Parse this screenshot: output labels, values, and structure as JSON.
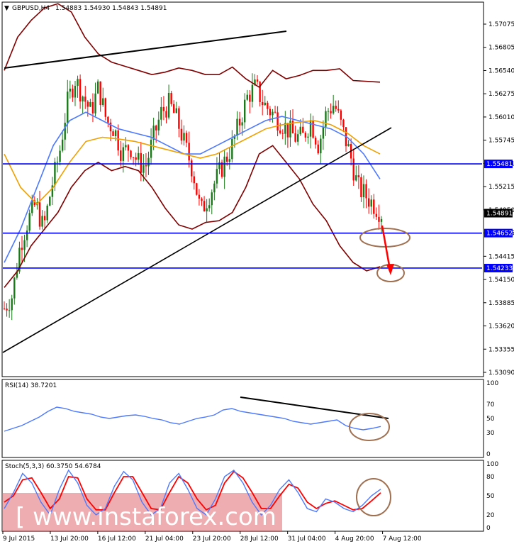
{
  "header": {
    "symbol": "GBPUSD,H4",
    "ohlc": "1.54883 1.54930 1.54843 1.54891"
  },
  "colors": {
    "bull_candle": "#1a7a1a",
    "bear_candle": "#ff0000",
    "bollinger": "#800000",
    "ma_fast": "#ff0000",
    "ma_mid": "#4d79ff",
    "ma_slow": "#f0a000",
    "level_line": "#0000ff",
    "annotation": "#a07050"
  },
  "watermark": {
    "text": "[ www.instaforex.com ]"
  },
  "chart_data": [
    {
      "type": "candlestick",
      "name": "main",
      "ylim": [
        1.5295,
        1.5741
      ],
      "y_ticks": [
        "1.57075",
        "1.56805",
        "1.56540",
        "1.56275",
        "1.56010",
        "1.55745",
        "1.55481",
        "1.55215",
        "1.54950",
        "1.54685",
        "1.54415",
        "1.54150",
        "1.53885",
        "1.53620",
        "1.53355",
        "1.53090"
      ],
      "x_ticks": [
        "9 Jul 2015",
        "13 Jul 20:00",
        "16 Jul 12:00",
        "21 Jul 04:00",
        "23 Jul 20:00",
        "28 Jul 12:00",
        "31 Jul 04:00",
        "4 Aug 20:00",
        "7 Aug 12:00"
      ],
      "levels": [
        {
          "label": "1.55481",
          "value": 1.55481
        },
        {
          "label": "1.54652",
          "value": 1.54652
        },
        {
          "label": "1.54233",
          "value": 1.54233
        }
      ],
      "current_price_label": "1.54891",
      "current_price": 1.54891,
      "close_path": [
        1.5375,
        1.539,
        1.545,
        1.548,
        1.55,
        1.547,
        1.552,
        1.556,
        1.562,
        1.565,
        1.563,
        1.561,
        1.564,
        1.56,
        1.559,
        1.556,
        1.557,
        1.555,
        1.5545,
        1.558,
        1.561,
        1.562,
        1.56,
        1.557,
        1.554,
        1.549,
        1.551,
        1.553,
        1.555,
        1.557,
        1.56,
        1.563,
        1.564,
        1.562,
        1.561,
        1.56,
        1.559,
        1.558,
        1.558,
        1.56,
        1.557,
        1.561,
        1.562,
        1.559,
        1.556,
        1.552,
        1.551,
        1.55,
        1.5489
      ],
      "bollinger_upper": [
        1.566,
        1.57,
        1.572,
        1.5735,
        1.574,
        1.573,
        1.57,
        1.568,
        1.567,
        1.5665,
        1.566,
        1.5655,
        1.5658,
        1.5663,
        1.566,
        1.5655,
        1.5655,
        1.5664,
        1.565,
        1.564,
        1.566,
        1.565,
        1.5654,
        1.566,
        1.566,
        1.5662,
        1.5648,
        1.5647,
        1.5646
      ],
      "bollinger_lower": [
        1.54,
        1.542,
        1.545,
        1.547,
        1.549,
        1.552,
        1.554,
        1.555,
        1.554,
        1.5545,
        1.554,
        1.552,
        1.5495,
        1.5475,
        1.547,
        1.5478,
        1.548,
        1.549,
        1.552,
        1.556,
        1.557,
        1.555,
        1.553,
        1.55,
        1.548,
        1.545,
        1.543,
        1.542,
        1.5425
      ],
      "ma_mid": [
        1.543,
        1.547,
        1.552,
        1.557,
        1.56,
        1.561,
        1.56,
        1.559,
        1.5585,
        1.558,
        1.557,
        1.556,
        1.556,
        1.557,
        1.558,
        1.559,
        1.56,
        1.5605,
        1.56,
        1.5595,
        1.559,
        1.558,
        1.556,
        1.553
      ],
      "ma_slow": [
        1.556,
        1.552,
        1.55,
        1.552,
        1.555,
        1.5575,
        1.558,
        1.5578,
        1.5575,
        1.557,
        1.5565,
        1.556,
        1.5555,
        1.556,
        1.557,
        1.558,
        1.559,
        1.5595,
        1.5598,
        1.56,
        1.5595,
        1.5585,
        1.557,
        1.556
      ]
    },
    {
      "type": "line",
      "name": "rsi",
      "label": "RSI(14) 38.7201",
      "ylim": [
        0,
        100
      ],
      "y_ticks": [
        "100",
        "70",
        "50",
        "30",
        "0"
      ],
      "values": [
        32,
        36,
        40,
        46,
        52,
        60,
        66,
        64,
        60,
        58,
        56,
        52,
        50,
        52,
        54,
        55,
        53,
        50,
        48,
        44,
        42,
        46,
        50,
        52,
        55,
        62,
        64,
        60,
        58,
        56,
        54,
        52,
        50,
        46,
        44,
        42,
        44,
        46,
        48,
        40,
        36,
        34,
        36,
        38.7
      ]
    },
    {
      "type": "line",
      "name": "stochastic",
      "label": "Stoch(5,3,3) 60.3750 54.6784",
      "ylim": [
        0,
        100
      ],
      "y_ticks": [
        "100",
        "80",
        "50",
        "20",
        "0"
      ],
      "main": [
        30,
        55,
        85,
        70,
        40,
        20,
        60,
        90,
        70,
        35,
        20,
        30,
        65,
        88,
        75,
        40,
        20,
        30,
        70,
        85,
        60,
        30,
        20,
        45,
        80,
        90,
        70,
        40,
        20,
        35,
        60,
        75,
        55,
        30,
        25,
        45,
        40,
        30,
        25,
        35,
        50,
        60.375
      ],
      "signal": [
        40,
        50,
        75,
        78,
        55,
        30,
        45,
        80,
        78,
        45,
        28,
        28,
        55,
        80,
        80,
        55,
        30,
        28,
        55,
        80,
        70,
        45,
        28,
        35,
        70,
        88,
        78,
        55,
        30,
        30,
        50,
        68,
        62,
        40,
        30,
        38,
        42,
        35,
        28,
        30,
        42,
        54.6784
      ]
    }
  ]
}
